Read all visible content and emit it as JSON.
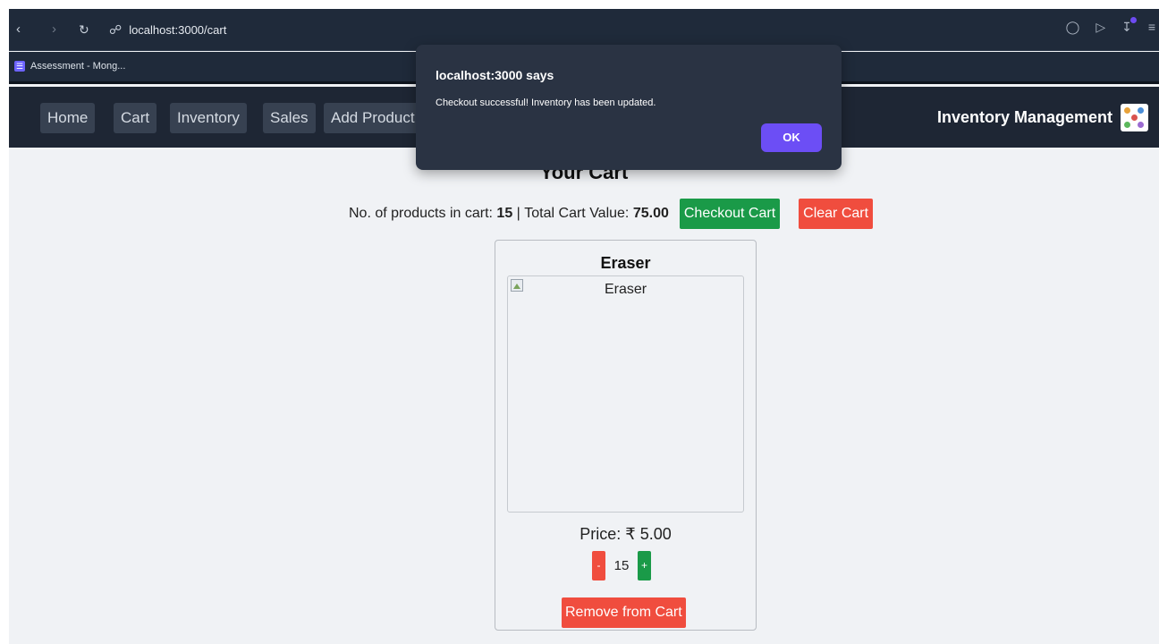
{
  "browser": {
    "url": "localhost:3000/cart",
    "bookmark_label": "Assessment - Mong..."
  },
  "navbar": {
    "links": [
      "Home",
      "Cart",
      "Inventory",
      "Sales",
      "Add Product"
    ],
    "brand": "Inventory Management"
  },
  "cart": {
    "title": "Your Cart",
    "count_label": "No. of products in cart:",
    "count": "15",
    "separator": "|",
    "total_label": "Total Cart Value:",
    "total": "75.00",
    "checkout_label": "Checkout Cart",
    "clear_label": "Clear Cart"
  },
  "product": {
    "name": "Eraser",
    "image_alt": "Eraser",
    "price": "Price: ₹ 5.00",
    "decrement": "-",
    "quantity": "15",
    "increment": "+",
    "remove_label": "Remove from Cart"
  },
  "dialog": {
    "title": "localhost:3000 says",
    "message": "Checkout successful! Inventory has been updated.",
    "ok_label": "OK"
  },
  "colors": {
    "green_button": "#1a9a48",
    "red_button": "#f04d3e",
    "dialog_ok": "#6c4ef5",
    "navbar_bg": "#1e2634"
  }
}
